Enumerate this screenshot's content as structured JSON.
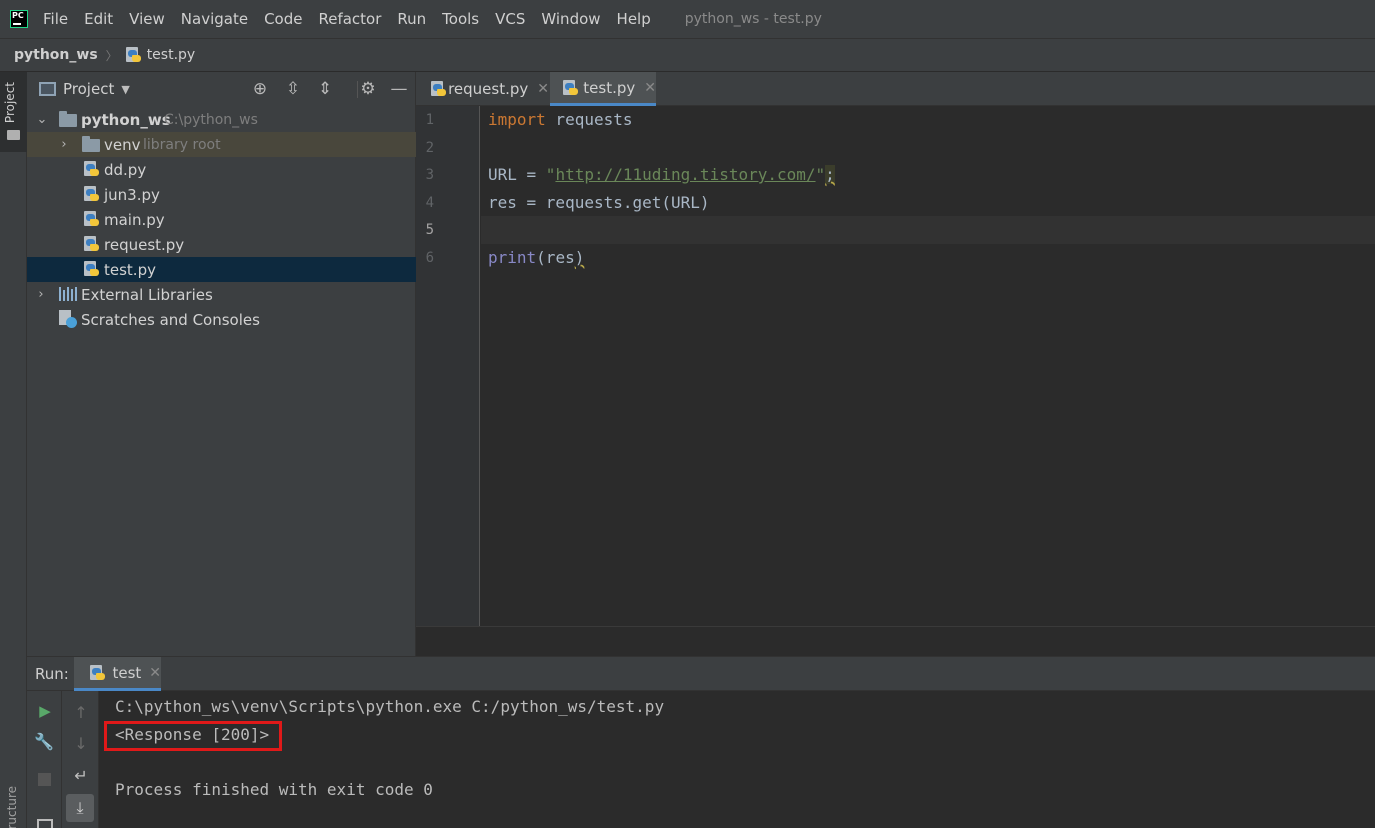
{
  "menu": {
    "items": [
      "File",
      "Edit",
      "View",
      "Navigate",
      "Code",
      "Refactor",
      "Run",
      "Tools",
      "VCS",
      "Window",
      "Help"
    ],
    "window_title": "python_ws - test.py"
  },
  "breadcrumb": {
    "project": "python_ws",
    "file": "test.py"
  },
  "left_strip": {
    "project_tab": "Project",
    "structure_tab": "ructure"
  },
  "project_panel": {
    "view_label": "Project",
    "tree": [
      {
        "label": "python_ws",
        "hint": "C:\\python_ws",
        "type": "folder",
        "expanded": true
      },
      {
        "label": "venv",
        "hint": "library root",
        "type": "folder",
        "expanded": false
      },
      {
        "label": "dd.py",
        "type": "python-file"
      },
      {
        "label": "jun3.py",
        "type": "python-file"
      },
      {
        "label": "main.py",
        "type": "python-file"
      },
      {
        "label": "request.py",
        "type": "python-file"
      },
      {
        "label": "test.py",
        "type": "python-file",
        "selected": true
      },
      {
        "label": "External Libraries",
        "type": "libraries"
      },
      {
        "label": "Scratches and Consoles",
        "type": "scratches"
      }
    ]
  },
  "editor": {
    "tabs": [
      {
        "label": "request.py",
        "active": false
      },
      {
        "label": "test.py",
        "active": true
      }
    ],
    "line_numbers": [
      "1",
      "2",
      "3",
      "4",
      "5",
      "6"
    ],
    "current_line": "5",
    "code": {
      "l1_kw": "import",
      "l1_rest": " requests",
      "l3_a": "URL = ",
      "l3_q1": "\"",
      "l3_url": "http://11uding.tistory.com/",
      "l3_q2": "\"",
      "l3_semi": ";",
      "l4": "res = requests.get(URL)",
      "l6_fn": "print",
      "l6_rest": "(res",
      "l6_close": ")"
    }
  },
  "run_panel": {
    "title": "Run:",
    "tab": "test",
    "console": [
      "C:\\python_ws\\venv\\Scripts\\python.exe C:/python_ws/test.py",
      "<Response [200]>",
      "",
      "Process finished with exit code 0"
    ]
  },
  "colors": {
    "keyword": "#cc7832",
    "string": "#6a8759",
    "builtin": "#8888c6",
    "selection": "#0d293e",
    "highlight_box": "#e01919"
  }
}
